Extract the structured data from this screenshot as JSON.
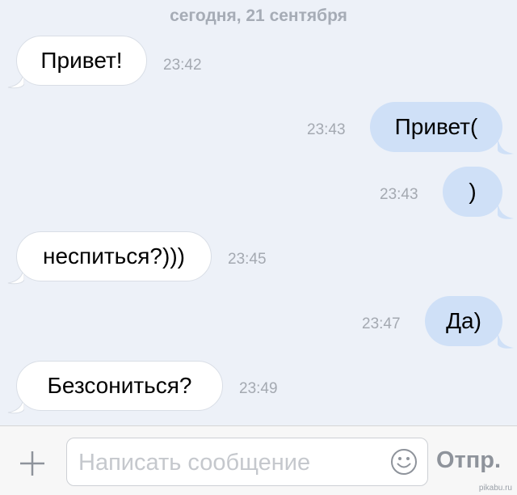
{
  "chat": {
    "date_separator": "сегодня, 21 сентября",
    "messages": [
      {
        "direction": "in",
        "text": "Привет!",
        "time": "23:42"
      },
      {
        "direction": "out",
        "text": "Привет(",
        "time": "23:43"
      },
      {
        "direction": "out",
        "text": ")",
        "time": "23:43"
      },
      {
        "direction": "in",
        "text": "неспиться?)))",
        "time": "23:45"
      },
      {
        "direction": "out",
        "text": "Да)",
        "time": "23:47"
      },
      {
        "direction": "in",
        "text": "Безсониться?",
        "time": "23:49"
      }
    ]
  },
  "composer": {
    "placeholder": "Написать сообщение",
    "value": "",
    "send_label": "Отпр.",
    "attach_icon": "plus-icon",
    "emoji_icon": "smiley-icon"
  },
  "watermark": "pikabu.ru",
  "colors": {
    "background": "#edf1f8",
    "incoming_bubble": "#ffffff",
    "outgoing_bubble": "#cfe0f7",
    "timestamp": "#a4a9b1"
  }
}
